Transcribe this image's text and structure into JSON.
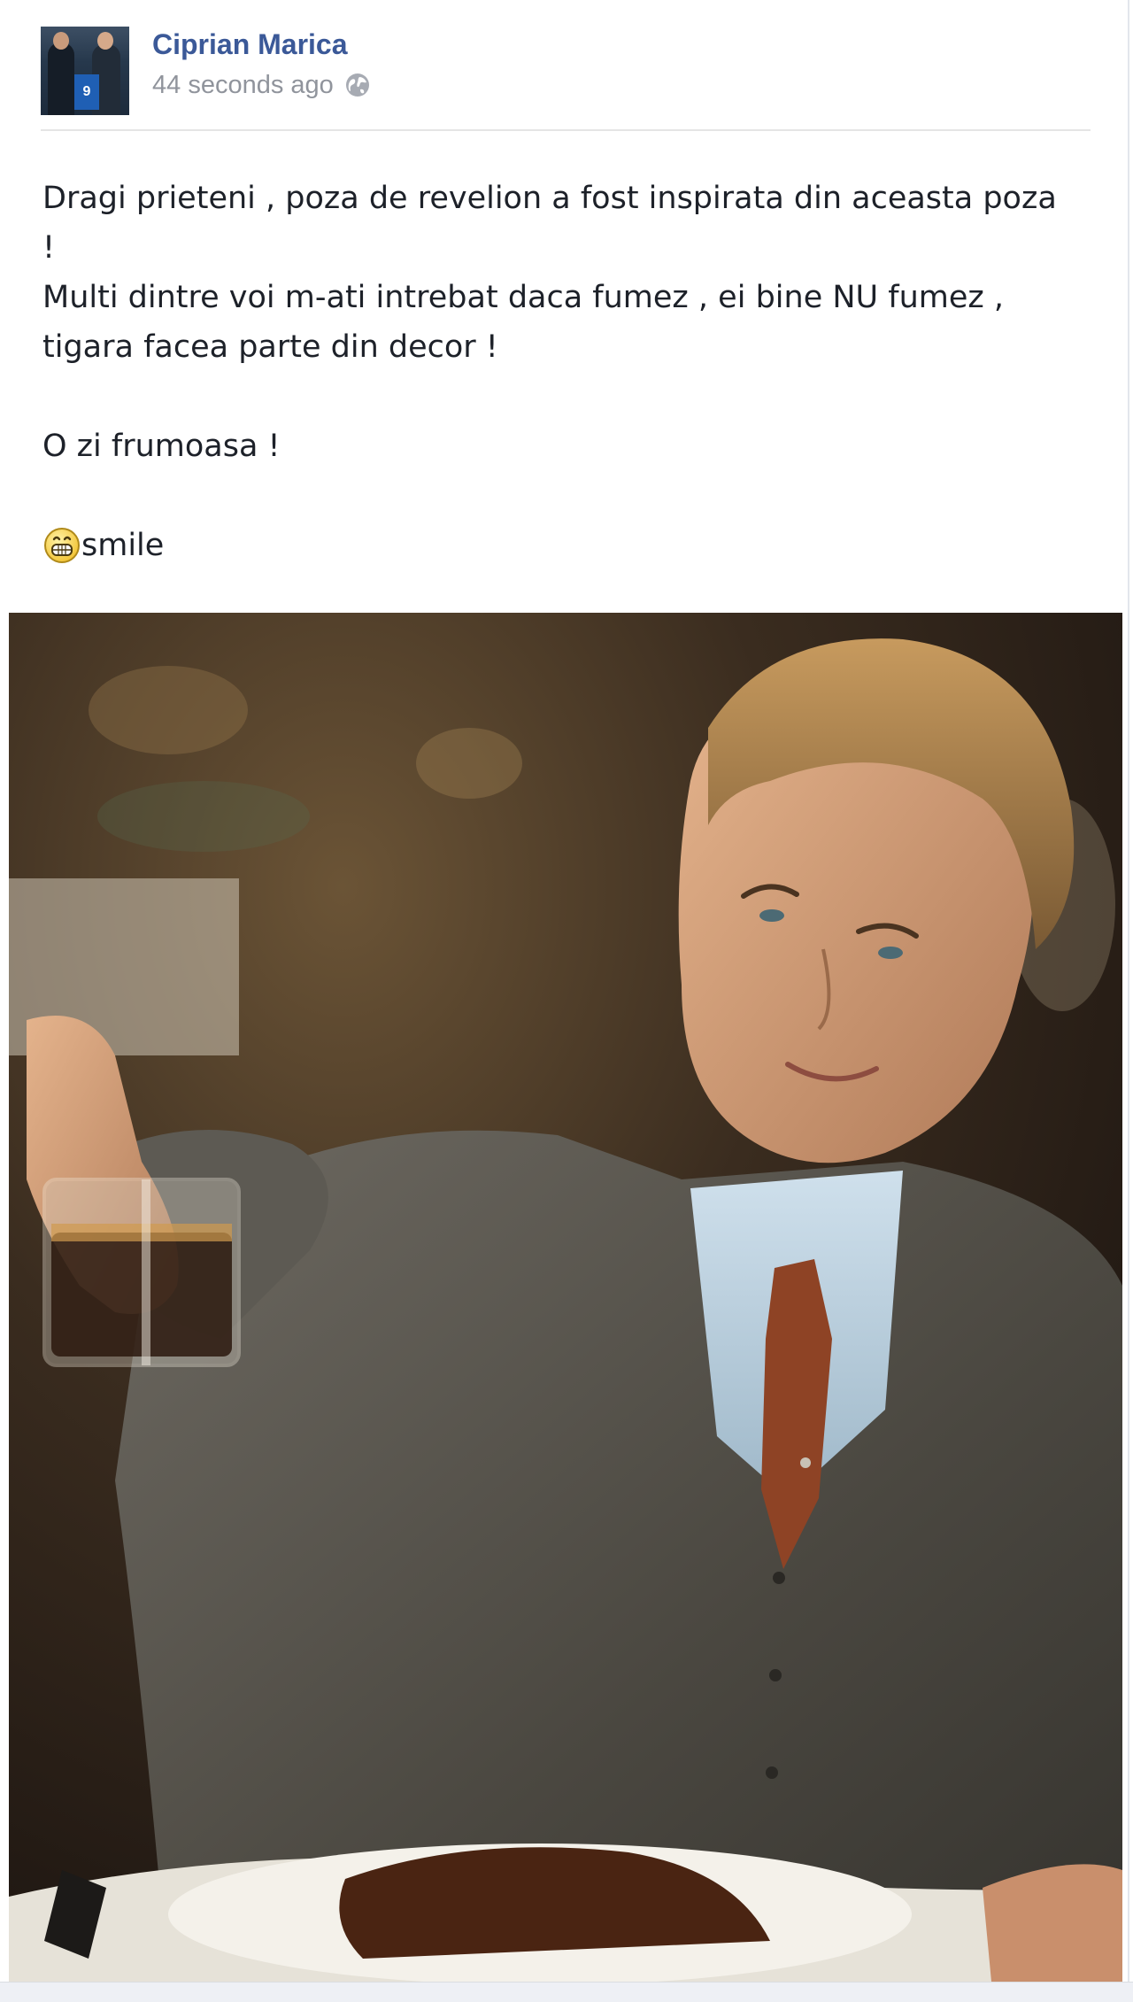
{
  "post": {
    "author": {
      "name": "Ciprian Marica",
      "avatar_icon": "profile-photo"
    },
    "timestamp": "44 seconds ago",
    "audience_icon": "globe-icon",
    "message": {
      "line1": "Dragi prieteni , poza de revelion a fost inspirata din aceasta poza",
      "line2": "!",
      "line3": "Multi dintre voi m-ati intrebat daca fumez , ei bine NU fumez ,",
      "line4": "tigara facea parte din decor !",
      "line5": "O zi frumoasa !",
      "smile_label": "smile"
    },
    "photo": {
      "alt": "man in grey suit raising a glass of whiskey at a dinner table"
    },
    "colors": {
      "author_link": "#3b5998",
      "timestamp": "#90949c",
      "text": "#1d2129"
    },
    "avatar_jersey_number": "9"
  }
}
